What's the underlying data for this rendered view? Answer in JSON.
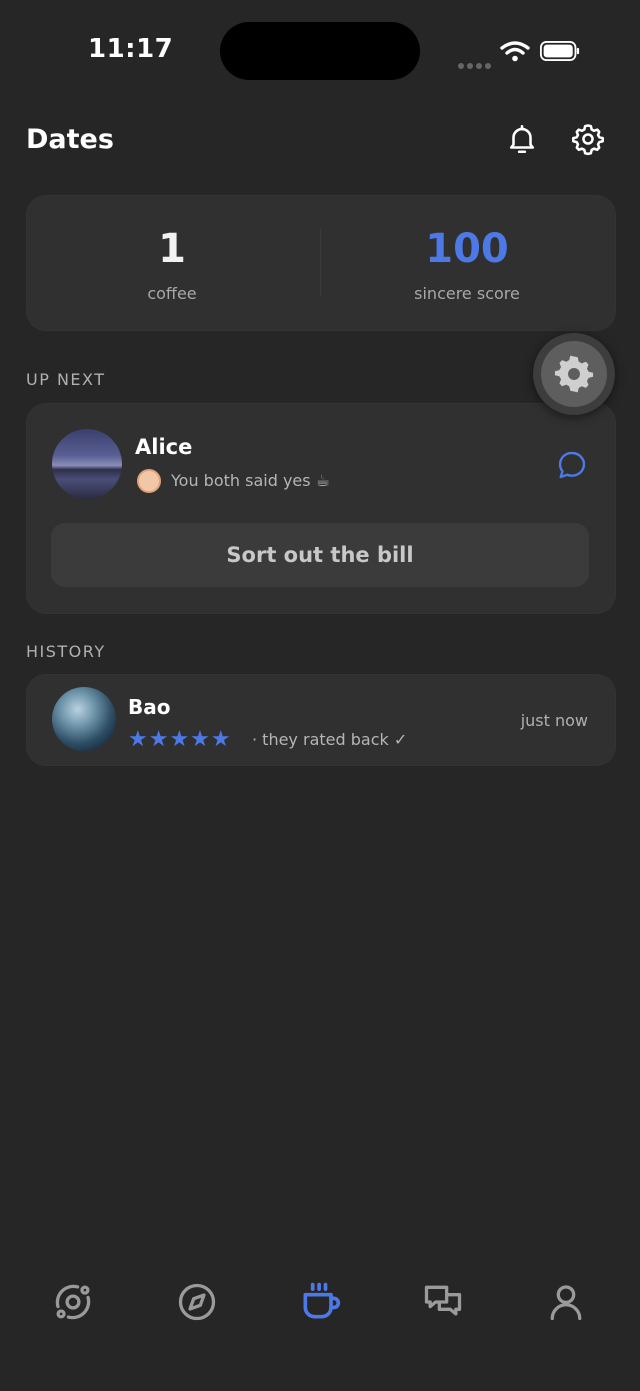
{
  "status_bar": {
    "time": "11:17"
  },
  "header": {
    "title": "Dates"
  },
  "stats": [
    {
      "value": "1",
      "label": "coffee",
      "color": "#f2f2f2"
    },
    {
      "value": "100",
      "label": "sincere score",
      "color": "#4d79e6"
    }
  ],
  "up_next": {
    "section_label": "UP NEXT",
    "name": "Alice",
    "status": "You both said yes ☕",
    "action_label": "Sort out the bill"
  },
  "history": {
    "section_label": "HISTORY",
    "items": [
      {
        "name": "Bao",
        "rating": 5,
        "stars": "★★★★★",
        "note": "· they rated back ✓",
        "time": "just now"
      }
    ]
  },
  "colors": {
    "accent": "#4d79e6",
    "background": "#262626",
    "card": "#303030"
  },
  "tab_bar": {
    "items": [
      {
        "icon": "orbit-icon",
        "active": false
      },
      {
        "icon": "compass-icon",
        "active": false
      },
      {
        "icon": "coffee-cup-icon",
        "active": true
      },
      {
        "icon": "chat-bubbles-icon",
        "active": false
      },
      {
        "icon": "profile-icon",
        "active": false
      }
    ]
  }
}
